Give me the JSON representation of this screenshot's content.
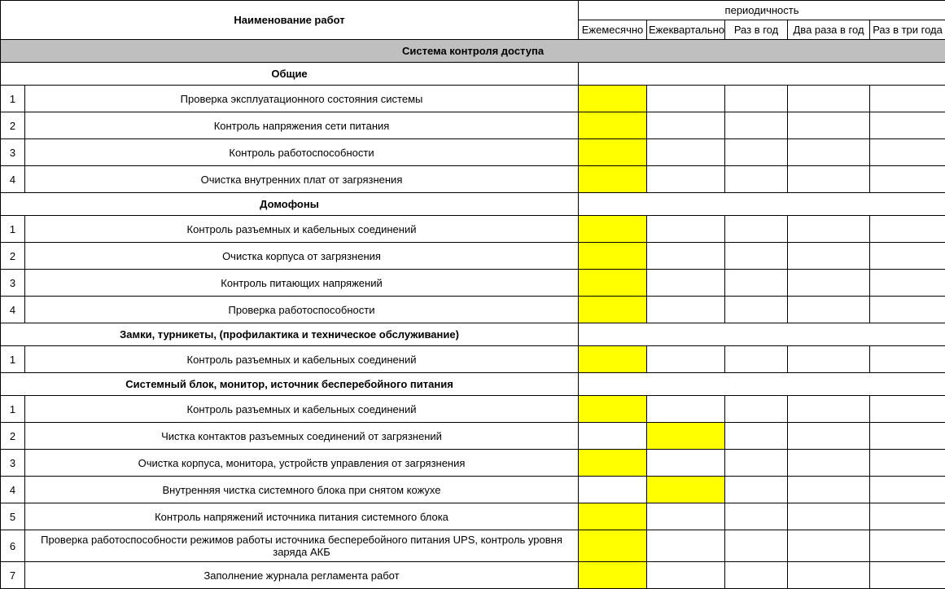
{
  "header": {
    "name_col": "Наименование работ",
    "periodicity": "периодичность",
    "cols": [
      "Ежемесячно",
      "Ежеквартально",
      "Раз в год",
      "Два раза в год",
      "Раз в три года"
    ]
  },
  "sections": [
    {
      "title_gray": "Система контроля доступа",
      "groups": [
        {
          "title": "Общие",
          "rows": [
            {
              "num": "1",
              "text": "Проверка эксплуатационного состояния системы",
              "freq": [
                true,
                false,
                false,
                false,
                false
              ]
            },
            {
              "num": "2",
              "text": "Контроль напряжения сети питания",
              "freq": [
                true,
                false,
                false,
                false,
                false
              ]
            },
            {
              "num": "3",
              "text": "Контроль работоспособности",
              "freq": [
                true,
                false,
                false,
                false,
                false
              ]
            },
            {
              "num": "4",
              "text": "Очистка  внутренних плат от загрязнения",
              "freq": [
                true,
                false,
                false,
                false,
                false
              ]
            }
          ]
        },
        {
          "title": "Домофоны",
          "rows": [
            {
              "num": "1",
              "text": "Контроль разъемных и кабельных соединений",
              "freq": [
                true,
                false,
                false,
                false,
                false
              ]
            },
            {
              "num": "2",
              "text": "Очистка корпуса от загрязнения",
              "freq": [
                true,
                false,
                false,
                false,
                false
              ]
            },
            {
              "num": "3",
              "text": "Контроль питающих напряжений",
              "freq": [
                true,
                false,
                false,
                false,
                false
              ]
            },
            {
              "num": "4",
              "text": "Проверка работоспособности",
              "freq": [
                true,
                false,
                false,
                false,
                false
              ]
            }
          ]
        },
        {
          "title": "Замки, турникеты,  (профилактика и техническое обслуживание)",
          "rows": [
            {
              "num": "1",
              "text": "Контроль разъемных и кабельных соединений",
              "freq": [
                true,
                false,
                false,
                false,
                false
              ]
            }
          ]
        },
        {
          "title": "Системный  блок, монитор, источник бесперебойного питания",
          "rows": [
            {
              "num": "1",
              "text": "Контроль разъемных и кабельных соединений",
              "freq": [
                true,
                false,
                false,
                false,
                false
              ]
            },
            {
              "num": "2",
              "text": "Чистка контактов разъемных соединений от загрязнений",
              "freq": [
                false,
                true,
                false,
                false,
                false
              ]
            },
            {
              "num": "3",
              "text": "Очистка корпуса, монитора, устройств управления от загрязнения",
              "freq": [
                true,
                false,
                false,
                false,
                false
              ]
            },
            {
              "num": "4",
              "text": "Внутренняя чистка системного блока при снятом кожухе",
              "freq": [
                false,
                true,
                false,
                false,
                false
              ]
            },
            {
              "num": "5",
              "text": "Контроль напряжений источника питания системного блока",
              "freq": [
                true,
                false,
                false,
                false,
                false
              ]
            },
            {
              "num": "6",
              "text": "Проверка работоспособности режимов работы источника бесперебойного питания UPS, контроль уровня заряда АКБ",
              "freq": [
                true,
                false,
                false,
                false,
                false
              ]
            },
            {
              "num": "7",
              "text": "Заполнение журнала регламента работ",
              "freq": [
                true,
                false,
                false,
                false,
                false
              ]
            }
          ]
        }
      ]
    }
  ]
}
